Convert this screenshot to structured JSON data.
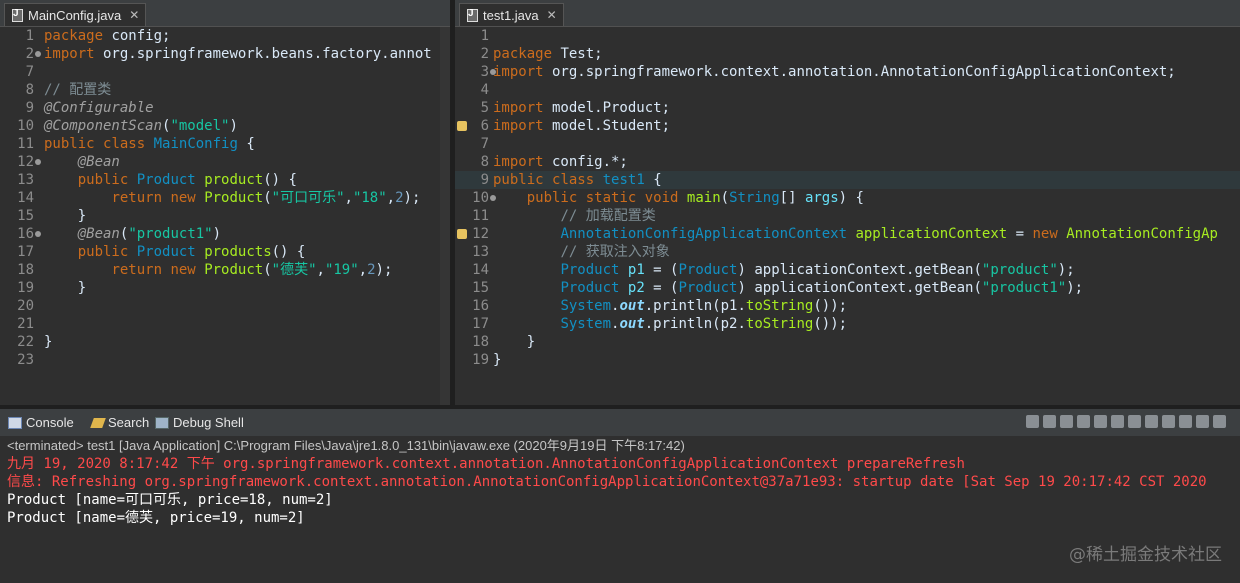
{
  "left_editor": {
    "tab_label": "MainConfig.java",
    "close_glyph": "✕",
    "lines": [
      {
        "n": "1",
        "tokens": [
          [
            "kw",
            "package"
          ],
          [
            "p",
            " config;"
          ]
        ]
      },
      {
        "n": "2",
        "fold": true,
        "tokens": [
          [
            "kw",
            "import"
          ],
          [
            "p",
            " org.springframework.beans.factory.annot"
          ]
        ]
      },
      {
        "n": "7",
        "tokens": []
      },
      {
        "n": "8",
        "tokens": [
          [
            "cm",
            "// 配置类"
          ]
        ]
      },
      {
        "n": "9",
        "tokens": [
          [
            "an",
            "@Configurable"
          ]
        ]
      },
      {
        "n": "10",
        "tokens": [
          [
            "an",
            "@ComponentScan"
          ],
          [
            "p",
            "("
          ],
          [
            "st",
            "\"model\""
          ],
          [
            "p",
            ")"
          ]
        ]
      },
      {
        "n": "11",
        "tokens": [
          [
            "kw",
            "public"
          ],
          [
            "p",
            " "
          ],
          [
            "kw",
            "class"
          ],
          [
            "p",
            " "
          ],
          [
            "ty",
            "MainConfig"
          ],
          [
            "p",
            " {"
          ]
        ]
      },
      {
        "n": "12",
        "fold": true,
        "tokens": [
          [
            "p",
            "    "
          ],
          [
            "an",
            "@Bean"
          ]
        ]
      },
      {
        "n": "13",
        "tokens": [
          [
            "p",
            "    "
          ],
          [
            "kw",
            "public"
          ],
          [
            "p",
            " "
          ],
          [
            "ty",
            "Product"
          ],
          [
            "p",
            " "
          ],
          [
            "fn",
            "product"
          ],
          [
            "p",
            "() {"
          ]
        ]
      },
      {
        "n": "14",
        "tokens": [
          [
            "p",
            "        "
          ],
          [
            "kw",
            "return"
          ],
          [
            "p",
            " "
          ],
          [
            "kw",
            "new"
          ],
          [
            "p",
            " "
          ],
          [
            "fn",
            "Product"
          ],
          [
            "p",
            "("
          ],
          [
            "st",
            "\"可口可乐\""
          ],
          [
            "p",
            ","
          ],
          [
            "st",
            "\"18\""
          ],
          [
            "p",
            ","
          ],
          [
            "nm",
            "2"
          ],
          [
            "p",
            ");"
          ]
        ]
      },
      {
        "n": "15",
        "tokens": [
          [
            "p",
            "    }"
          ]
        ]
      },
      {
        "n": "16",
        "fold": true,
        "tokens": [
          [
            "p",
            "    "
          ],
          [
            "an",
            "@Bean"
          ],
          [
            "p",
            "("
          ],
          [
            "st",
            "\"product1\""
          ],
          [
            "p",
            ")"
          ]
        ]
      },
      {
        "n": "17",
        "tokens": [
          [
            "p",
            "    "
          ],
          [
            "kw",
            "public"
          ],
          [
            "p",
            " "
          ],
          [
            "ty",
            "Product"
          ],
          [
            "p",
            " "
          ],
          [
            "fn",
            "products"
          ],
          [
            "p",
            "() {"
          ]
        ]
      },
      {
        "n": "18",
        "tokens": [
          [
            "p",
            "        "
          ],
          [
            "kw",
            "return"
          ],
          [
            "p",
            " "
          ],
          [
            "kw",
            "new"
          ],
          [
            "p",
            " "
          ],
          [
            "fn",
            "Product"
          ],
          [
            "p",
            "("
          ],
          [
            "st",
            "\"德芙\""
          ],
          [
            "p",
            ","
          ],
          [
            "st",
            "\"19\""
          ],
          [
            "p",
            ","
          ],
          [
            "nm",
            "2"
          ],
          [
            "p",
            ");"
          ]
        ]
      },
      {
        "n": "19",
        "tokens": [
          [
            "p",
            "    }"
          ]
        ]
      },
      {
        "n": "20",
        "tokens": []
      },
      {
        "n": "21",
        "tokens": []
      },
      {
        "n": "22",
        "tokens": [
          [
            "p",
            "}"
          ]
        ]
      },
      {
        "n": "23",
        "tokens": []
      }
    ]
  },
  "right_editor": {
    "tab_label": "test1.java",
    "close_glyph": "✕",
    "lines": [
      {
        "n": "1",
        "tokens": []
      },
      {
        "n": "2",
        "tokens": [
          [
            "kw",
            "package"
          ],
          [
            "p",
            " Test;"
          ]
        ]
      },
      {
        "n": "3",
        "fold": true,
        "tokens": [
          [
            "kw",
            "import"
          ],
          [
            "p",
            " org.springframework.context.annotation.AnnotationConfigApplicationContext;"
          ]
        ]
      },
      {
        "n": "4",
        "tokens": []
      },
      {
        "n": "5",
        "tokens": [
          [
            "kw",
            "import"
          ],
          [
            "p",
            " model.Product;"
          ]
        ]
      },
      {
        "n": "6",
        "warn": true,
        "tokens": [
          [
            "kw",
            "import"
          ],
          [
            "p",
            " model.Student;"
          ]
        ]
      },
      {
        "n": "7",
        "tokens": []
      },
      {
        "n": "8",
        "tokens": [
          [
            "kw",
            "import"
          ],
          [
            "p",
            " config.*;"
          ]
        ]
      },
      {
        "n": "9",
        "current": true,
        "tokens": [
          [
            "kw",
            "public"
          ],
          [
            "p",
            " "
          ],
          [
            "kw",
            "class"
          ],
          [
            "p",
            " "
          ],
          [
            "ty",
            "test1"
          ],
          [
            "p",
            " {"
          ]
        ]
      },
      {
        "n": "10",
        "fold": true,
        "tokens": [
          [
            "p",
            "    "
          ],
          [
            "kw",
            "public"
          ],
          [
            "p",
            " "
          ],
          [
            "kw",
            "static"
          ],
          [
            "p",
            " "
          ],
          [
            "kw",
            "void"
          ],
          [
            "p",
            " "
          ],
          [
            "fn",
            "main"
          ],
          [
            "p",
            "("
          ],
          [
            "ty",
            "String"
          ],
          [
            "p",
            "[] "
          ],
          [
            "vr",
            "args"
          ],
          [
            "p",
            ") {"
          ]
        ]
      },
      {
        "n": "11",
        "tokens": [
          [
            "p",
            "        "
          ],
          [
            "cm",
            "// 加载配置类"
          ]
        ]
      },
      {
        "n": "12",
        "warn": true,
        "tokens": [
          [
            "p",
            "        "
          ],
          [
            "ty",
            "AnnotationConfigApplicationContext"
          ],
          [
            "p",
            " "
          ],
          [
            "fn",
            "applicationContext"
          ],
          [
            "p",
            " = "
          ],
          [
            "kw",
            "new"
          ],
          [
            "p",
            " "
          ],
          [
            "fn",
            "AnnotationConfigAp"
          ]
        ]
      },
      {
        "n": "13",
        "tokens": [
          [
            "p",
            "        "
          ],
          [
            "cm",
            "// 获取注入对象"
          ]
        ]
      },
      {
        "n": "14",
        "tokens": [
          [
            "p",
            "        "
          ],
          [
            "ty",
            "Product"
          ],
          [
            "p",
            " "
          ],
          [
            "vr",
            "p1"
          ],
          [
            "p",
            " = ("
          ],
          [
            "ty",
            "Product"
          ],
          [
            "p",
            ") applicationContext.getBean("
          ],
          [
            "st",
            "\"product\""
          ],
          [
            "p",
            ");"
          ]
        ]
      },
      {
        "n": "15",
        "tokens": [
          [
            "p",
            "        "
          ],
          [
            "ty",
            "Product"
          ],
          [
            "p",
            " "
          ],
          [
            "vr",
            "p2"
          ],
          [
            "p",
            " = ("
          ],
          [
            "ty",
            "Product"
          ],
          [
            "p",
            ") applicationContext.getBean("
          ],
          [
            "st",
            "\"product1\""
          ],
          [
            "p",
            ");"
          ]
        ]
      },
      {
        "n": "16",
        "tokens": [
          [
            "p",
            "        "
          ],
          [
            "ty",
            "System"
          ],
          [
            "p",
            "."
          ],
          [
            "it",
            "out"
          ],
          [
            "p",
            ".println(p1."
          ],
          [
            "fn",
            "toString"
          ],
          [
            "p",
            "());"
          ]
        ]
      },
      {
        "n": "17",
        "tokens": [
          [
            "p",
            "        "
          ],
          [
            "ty",
            "System"
          ],
          [
            "p",
            "."
          ],
          [
            "it",
            "out"
          ],
          [
            "p",
            ".println(p2."
          ],
          [
            "fn",
            "toString"
          ],
          [
            "p",
            "());"
          ]
        ]
      },
      {
        "n": "18",
        "tokens": [
          [
            "p",
            "    }"
          ]
        ]
      },
      {
        "n": "19",
        "tokens": [
          [
            "p",
            "}"
          ]
        ]
      }
    ]
  },
  "console": {
    "tabs": [
      {
        "label": "Console",
        "icon": "console-icon"
      },
      {
        "label": "Search",
        "icon": "search-icon"
      },
      {
        "label": "Debug Shell",
        "icon": "debug-shell-icon"
      }
    ],
    "terminated": "<terminated> test1 [Java Application] C:\\Program Files\\Java\\jre1.8.0_131\\bin\\javaw.exe (2020年9月19日 下午8:17:42)",
    "lines": [
      {
        "cls": "err",
        "text": "九月 19, 2020 8:17:42 下午 org.springframework.context.annotation.AnnotationConfigApplicationContext prepareRefresh"
      },
      {
        "cls": "err",
        "text": "信息: Refreshing org.springframework.context.annotation.AnnotationConfigApplicationContext@37a71e93: startup date [Sat Sep 19 20:17:42 CST 2020"
      },
      {
        "cls": "out",
        "text": "Product [name=可口可乐, price=18, num=2]"
      },
      {
        "cls": "out",
        "text": "Product [name=德芙, price=19, num=2]"
      }
    ]
  },
  "watermark": "@稀土掘金技术社区"
}
